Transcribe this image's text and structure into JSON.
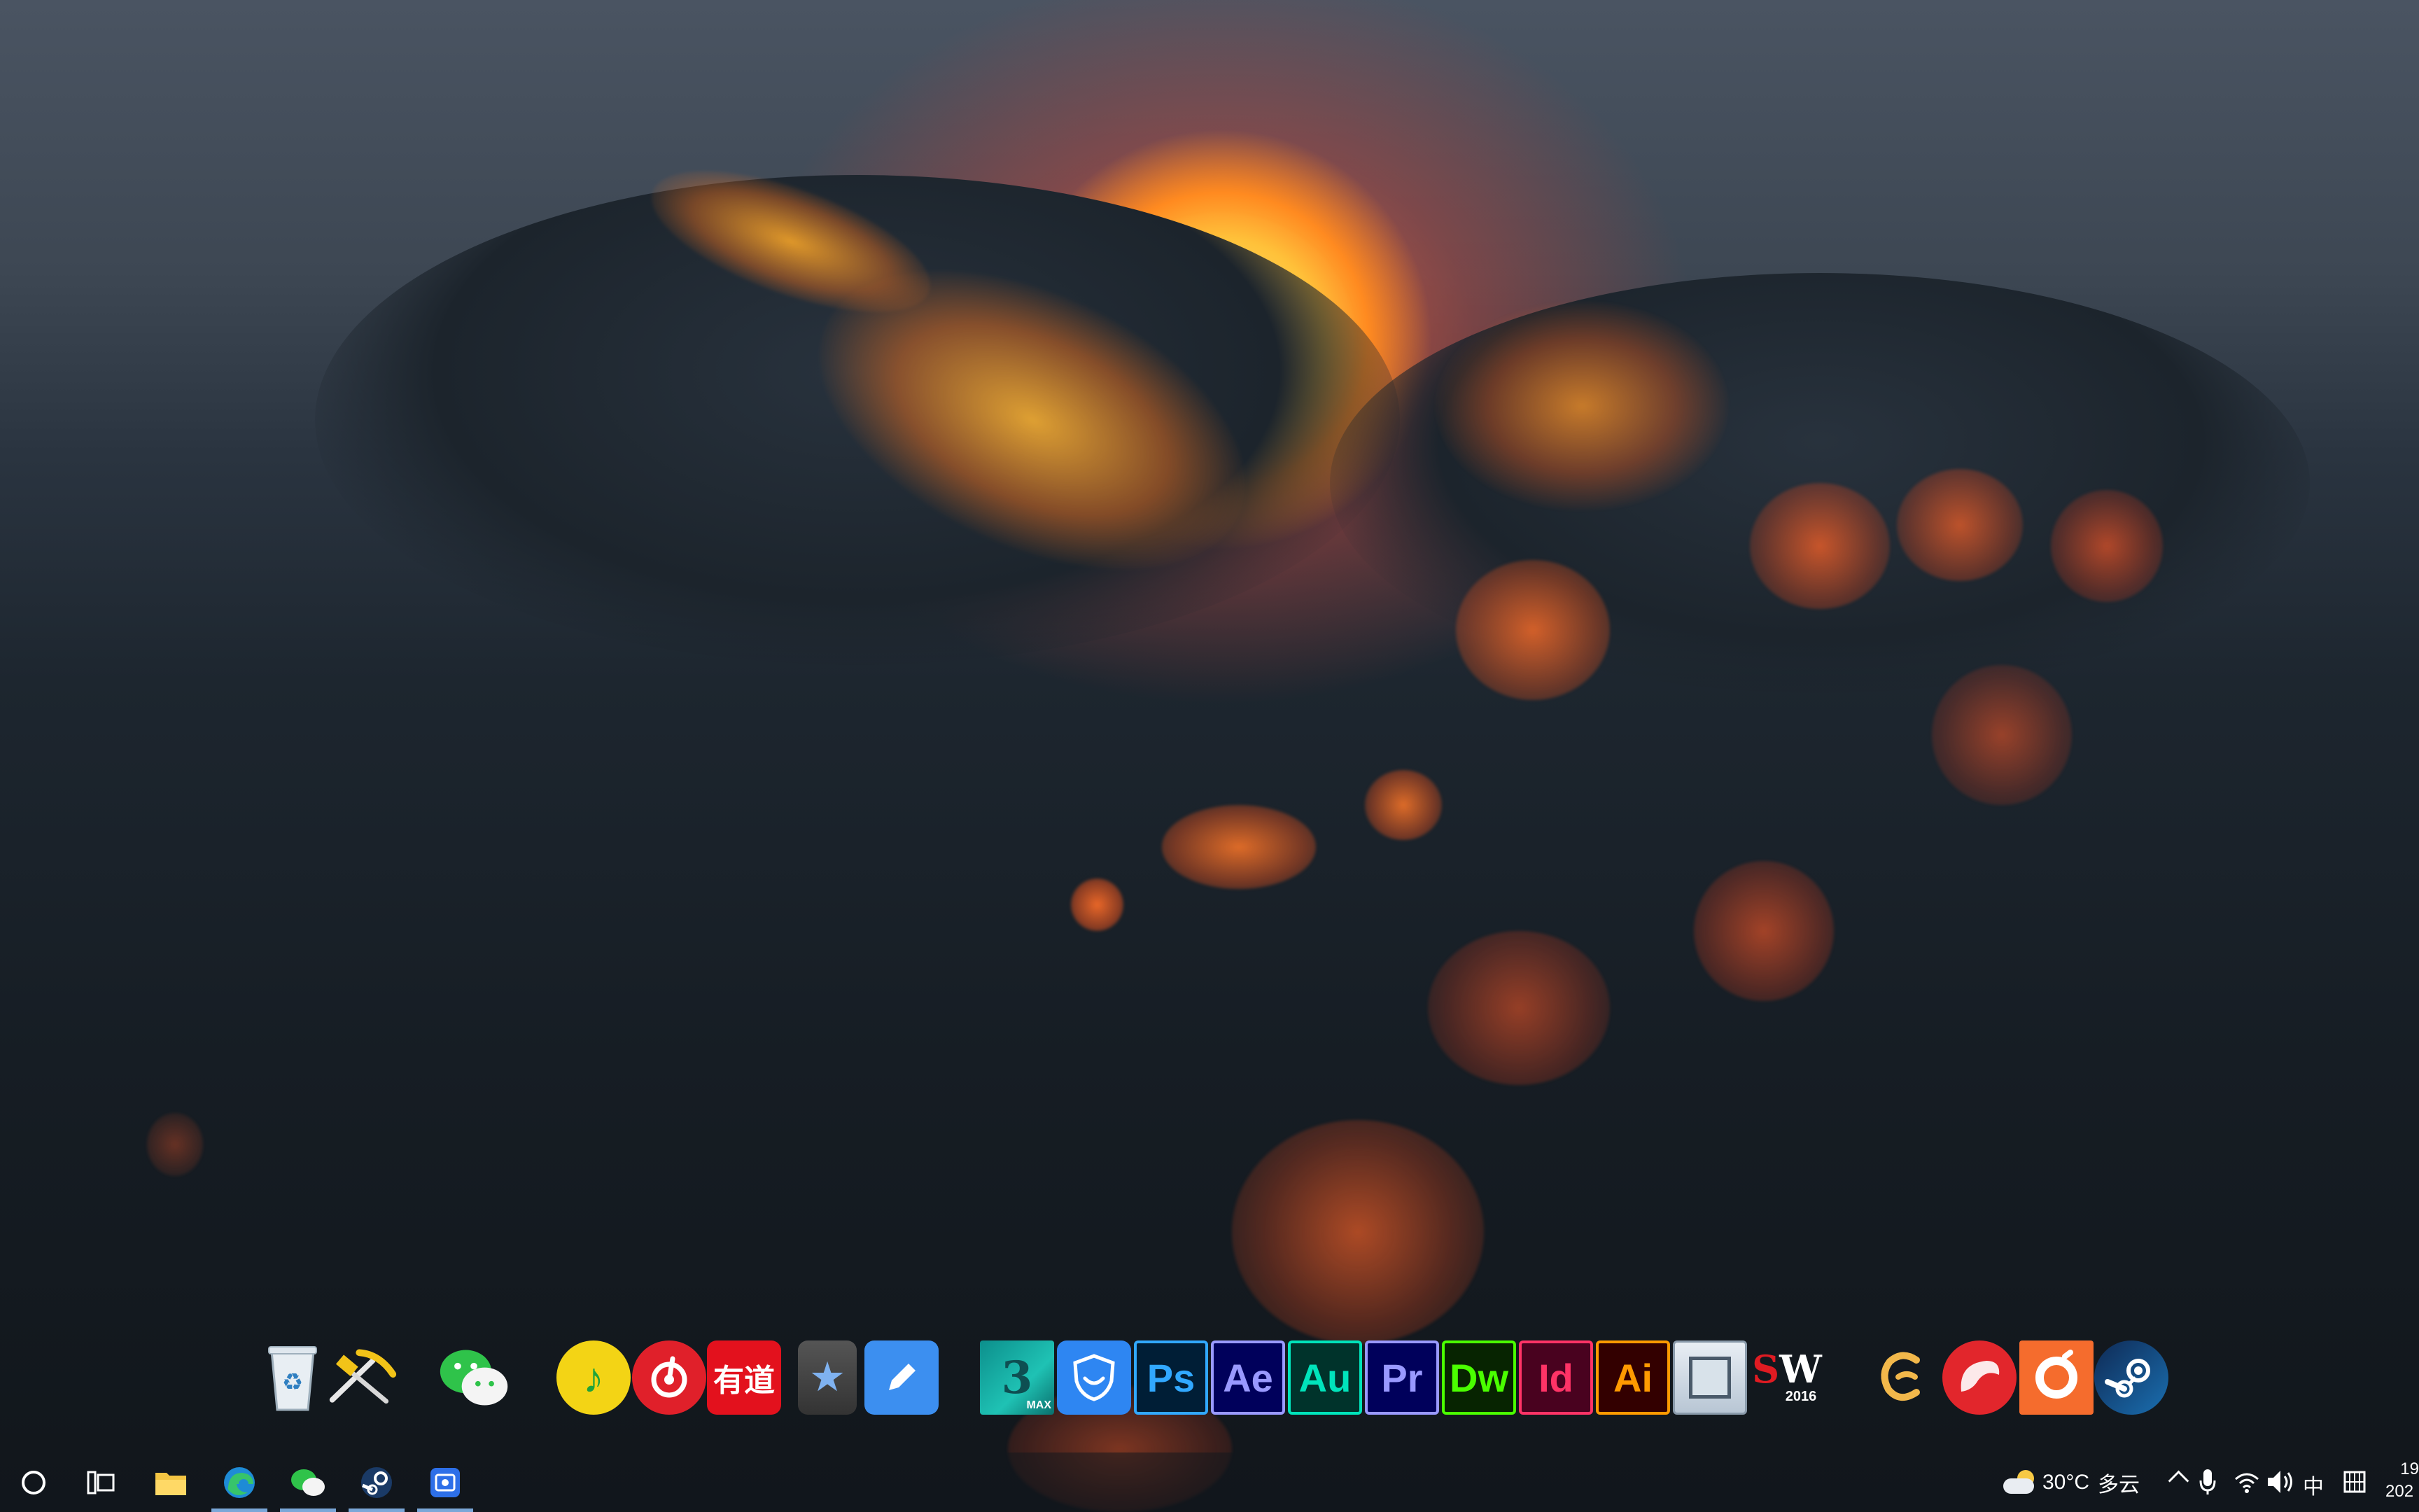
{
  "desktop": {
    "wallpaper": "ocean-wave-sunset"
  },
  "dock": {
    "items": [
      {
        "name": "recycle-bin",
        "icon": "recycle-bin-icon"
      },
      {
        "name": "tools",
        "icon": "hammer-pickaxe-icon"
      },
      {
        "name": "wechat",
        "icon": "wechat-icon"
      },
      {
        "name": "qq-music",
        "icon": "qq-music-icon"
      },
      {
        "name": "netease-music",
        "icon": "netease-cloud-music-icon"
      },
      {
        "name": "youdao",
        "icon": "youdao-icon",
        "label": "有道"
      },
      {
        "name": "stars-app",
        "icon": "stars-icon"
      },
      {
        "name": "notes",
        "icon": "pen-icon"
      },
      {
        "name": "3ds-max",
        "icon": "3ds-max-icon",
        "label": "MAX"
      },
      {
        "name": "security",
        "icon": "shield-smile-icon"
      },
      {
        "name": "photoshop",
        "icon": "photoshop-icon",
        "label": "Ps",
        "color": "#31a8ff"
      },
      {
        "name": "after-effects",
        "icon": "after-effects-icon",
        "label": "Ae",
        "color": "#9999ff"
      },
      {
        "name": "audition",
        "icon": "audition-icon",
        "label": "Au",
        "color": "#00e4bb"
      },
      {
        "name": "premiere",
        "icon": "premiere-icon",
        "label": "Pr",
        "color": "#9999ff"
      },
      {
        "name": "dreamweaver",
        "icon": "dreamweaver-icon",
        "label": "Dw",
        "color": "#4aff00"
      },
      {
        "name": "indesign",
        "icon": "indesign-icon",
        "label": "Id",
        "color": "#ff3366"
      },
      {
        "name": "illustrator",
        "icon": "illustrator-icon",
        "label": "Ai",
        "color": "#ff9a00"
      },
      {
        "name": "window-app",
        "icon": "window-icon"
      },
      {
        "name": "solidworks",
        "icon": "solidworks-icon",
        "label": "SW",
        "sublabel": "2016"
      },
      {
        "name": "ge-app",
        "icon": "ge-icon"
      },
      {
        "name": "dolphin-app",
        "icon": "dolphin-icon"
      },
      {
        "name": "origin",
        "icon": "origin-icon"
      },
      {
        "name": "steam",
        "icon": "steam-icon"
      }
    ]
  },
  "taskbar": {
    "buttons": [
      {
        "name": "search",
        "icon": "search-circle-icon",
        "active": false
      },
      {
        "name": "task-view",
        "icon": "task-view-icon",
        "active": false
      },
      {
        "name": "file-explorer",
        "icon": "folder-icon",
        "active": false
      },
      {
        "name": "edge",
        "icon": "edge-icon",
        "active": true
      },
      {
        "name": "wechat",
        "icon": "wechat-icon",
        "active": true
      },
      {
        "name": "steam",
        "icon": "steam-icon",
        "active": true
      },
      {
        "name": "screen-capture",
        "icon": "capture-icon",
        "active": true
      }
    ],
    "tray": {
      "weather_temp": "30°C",
      "weather_desc": "多云",
      "ime_label": "中",
      "clock_time": "19",
      "clock_date": "202"
    }
  },
  "colors": {
    "sun": "#ffc640",
    "sky": "#4a5462",
    "ocean": "#161d24",
    "taskbar_accent": "#7aa7d8"
  }
}
